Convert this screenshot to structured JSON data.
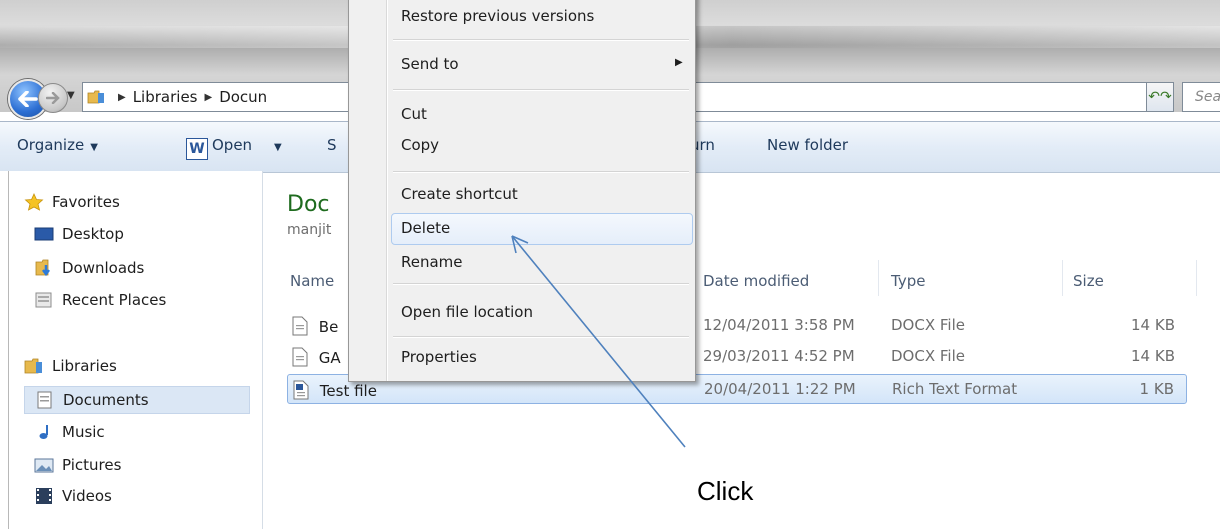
{
  "address_bar": {
    "crumbs": [
      "Libraries",
      "Docun"
    ],
    "search_placeholder": "Sea"
  },
  "command_bar": {
    "organize": "Organize",
    "open": "Open",
    "share_fragment": "S",
    "burn_fragment": "urn",
    "new_folder": "New folder"
  },
  "nav_pane": {
    "favorites": "Favorites",
    "desktop": "Desktop",
    "downloads": "Downloads",
    "recent_places": "Recent Places",
    "libraries": "Libraries",
    "documents": "Documents",
    "music": "Music",
    "pictures": "Pictures",
    "videos": "Videos"
  },
  "content": {
    "title_fragment": "Doc",
    "subtitle_fragment": "manjit",
    "columns": {
      "name": "Name",
      "date_modified": "Date modified",
      "type": "Type",
      "size": "Size"
    },
    "files": [
      {
        "name": "Be",
        "date": "12/04/2011 3:58 PM",
        "type": "DOCX File",
        "size": "14 KB",
        "selected": false
      },
      {
        "name": "GA",
        "date": "29/03/2011 4:52 PM",
        "type": "DOCX File",
        "size": "14 KB",
        "selected": false
      },
      {
        "name": "Test file",
        "date": "20/04/2011 1:22 PM",
        "type": "Rich Text Format",
        "size": "1 KB",
        "selected": true
      }
    ]
  },
  "context_menu": {
    "items": [
      "Restore previous versions",
      "Send to",
      "Cut",
      "Copy",
      "Create shortcut",
      "Delete",
      "Rename",
      "Open file location",
      "Properties"
    ],
    "hovered": "Delete"
  },
  "annotation": {
    "label": "Click"
  },
  "colors": {
    "folder_title": "#1e6b1e",
    "selection_border": "#8db2e3",
    "arrow": "#4f81bd"
  }
}
